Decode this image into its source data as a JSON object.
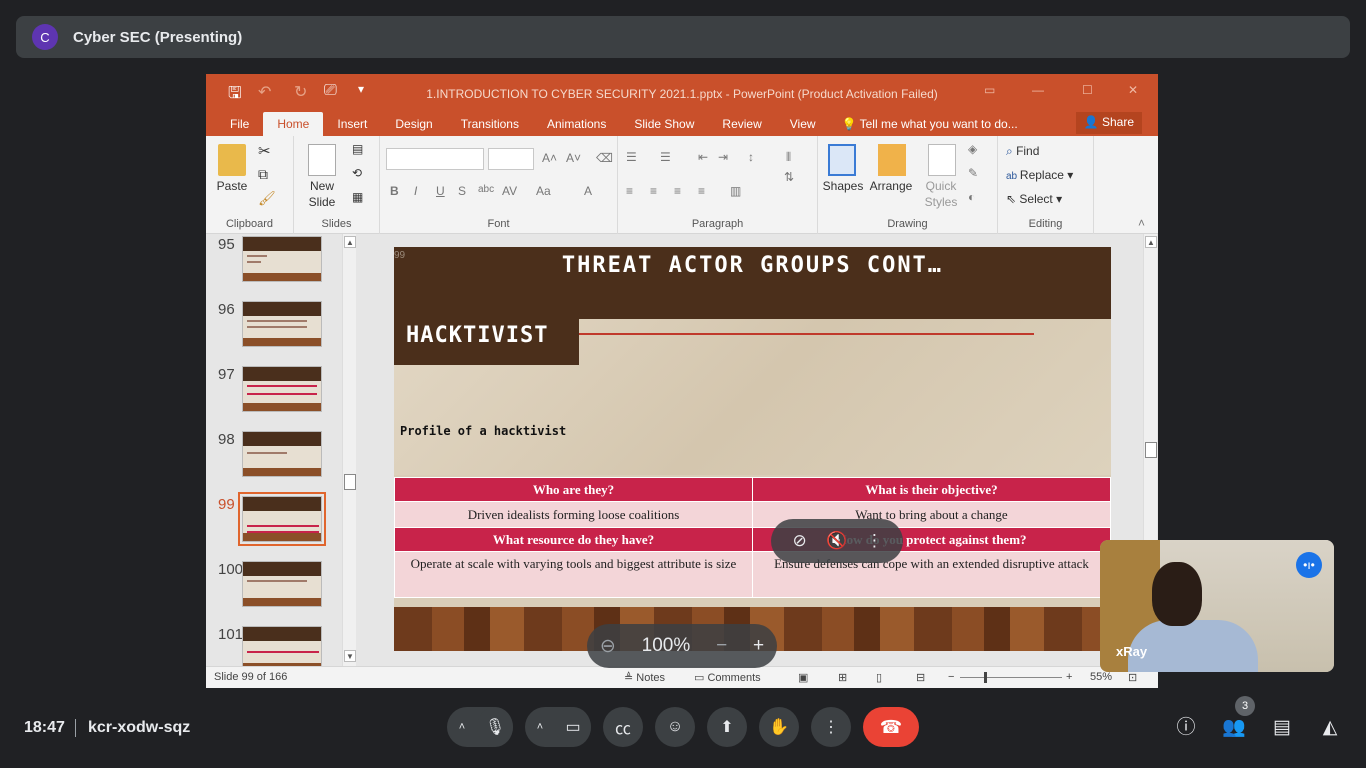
{
  "top_bar": {
    "avatar_letter": "C",
    "presenter": "Cyber SEC (Presenting)"
  },
  "powerpoint": {
    "doc_title": "1.INTRODUCTION TO CYBER SECURITY 2021.1.pptx - PowerPoint (Product Activation Failed)",
    "tabs": [
      "File",
      "Home",
      "Insert",
      "Design",
      "Transitions",
      "Animations",
      "Slide Show",
      "Review",
      "View"
    ],
    "active_tab": "Home",
    "tell_me": "Tell me what you want to do...",
    "share": "Share",
    "ribbon": {
      "paste": "Paste",
      "new_slide_1": "New",
      "new_slide_2": "Slide",
      "clipboard": "Clipboard",
      "slides": "Slides",
      "font": "Font",
      "paragraph": "Paragraph",
      "shapes": "Shapes",
      "arrange": "Arrange",
      "quick_1": "Quick",
      "quick_2": "Styles",
      "drawing": "Drawing",
      "find": "Find",
      "replace": "Replace",
      "select": "Select",
      "editing": "Editing"
    },
    "thumbnails": [
      "95",
      "96",
      "97",
      "98",
      "99",
      "100",
      "101"
    ],
    "active_thumbnail": "99",
    "slide": {
      "number": "99",
      "title": "THREAT ACTOR GROUPS CONT…",
      "subtitle": "HACKTIVIST",
      "profile": "Profile of a hacktivist",
      "table": {
        "h1": "Who are they?",
        "h2": "What is their objective?",
        "c1": "Driven idealists forming loose coalitions",
        "c2": "Want to bring about a change",
        "h3": "What resource do they have?",
        "h4": "How do you protect against them?",
        "c3": "Operate at scale with varying tools and biggest attribute is size",
        "c4": "Ensure defenses can cope with an extended disruptive attack"
      }
    },
    "status": {
      "slide_of": "Slide 99 of 166",
      "notes": "Notes",
      "comments": "Comments",
      "zoom": "55%"
    }
  },
  "zoom_pill": {
    "value": "100%"
  },
  "self_view": {
    "name": "xRay"
  },
  "bottom": {
    "time": "18:47",
    "meeting_code": "kcr-xodw-sqz",
    "participant_count": "3"
  }
}
